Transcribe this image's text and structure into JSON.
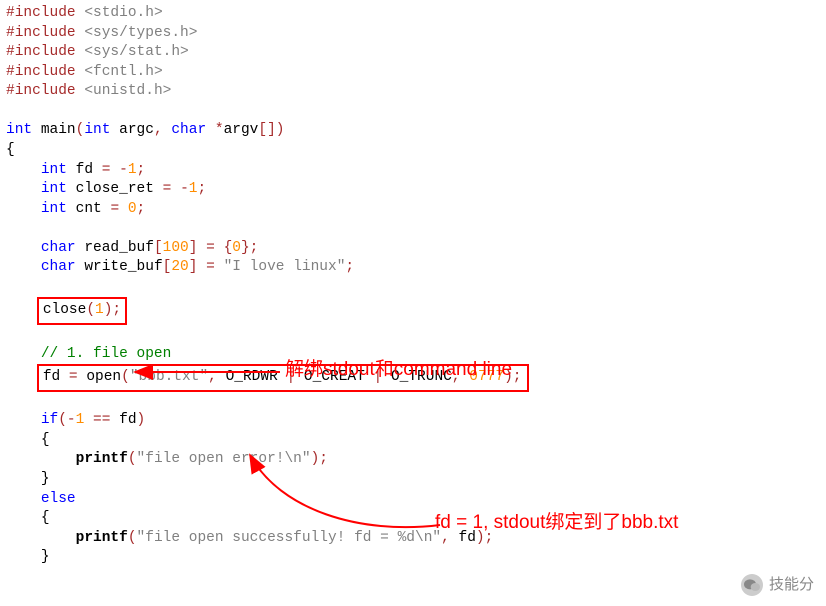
{
  "code": {
    "inc1": "stdio.h",
    "inc2": "sys/types.h",
    "inc3": "sys/stat.h",
    "inc4": "fcntl.h",
    "inc5": "unistd.h",
    "kw_include": "#include",
    "kw_int": "int",
    "kw_char": "char",
    "kw_if": "if",
    "kw_else": "else",
    "fn_main": "main",
    "fn_close": "close",
    "fn_open": "open",
    "fn_printf": "printf",
    "id_argc": "argc",
    "id_argv": "argv",
    "id_fd": "fd",
    "id_close_ret": "close_ret",
    "id_cnt": "cnt",
    "id_read_buf": "read_buf",
    "id_write_buf": "write_buf",
    "flag1": "O_RDWR",
    "flag2": "O_CREAT",
    "flag3": "O_TRUNC",
    "n_neg1": "-1",
    "n_0": "0",
    "n_1": "1",
    "n_100": "100",
    "n_20": "20",
    "n_0777": "0777",
    "str_love": "\"I love linux\"",
    "str_bbb": "\"bbb.txt\"",
    "str_err": "\"file open error!\\n\"",
    "str_ok": "\"file open successfully! fd = %d\\n\"",
    "cmt_open": "// 1. file open"
  },
  "annotations": {
    "a1": "解绑stdout和command line",
    "a2": "fd = 1, stdout绑定到了bbb.txt"
  },
  "watermark": {
    "text": "技能分"
  }
}
